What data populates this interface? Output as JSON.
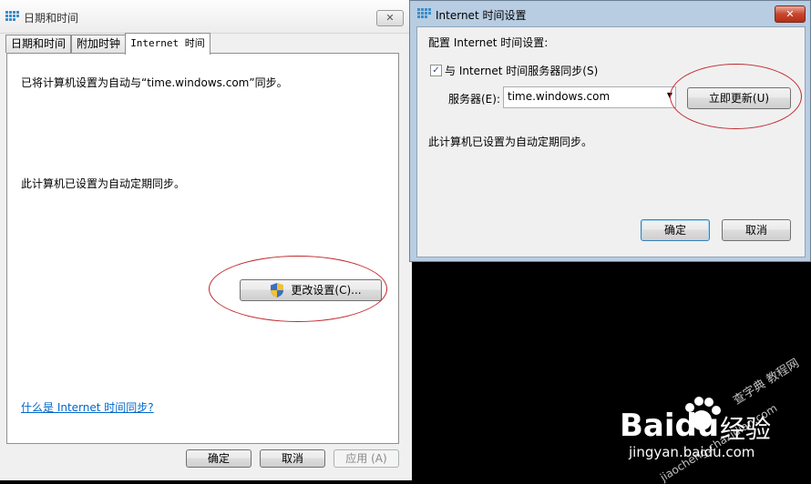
{
  "datetime_window": {
    "title": "日期和时间",
    "close_label": "✕",
    "tabs": [
      "日期和时间",
      "附加时钟",
      "Internet 时间"
    ],
    "status_line_1": "已将计算机设置为自动与“time.windows.com”同步。",
    "status_line_2": "此计算机已设置为自动定期同步。",
    "change_settings_label": "更改设置(C)...",
    "help_link": "什么是 Internet 时间同步?",
    "ok_label": "确定",
    "cancel_label": "取消",
    "apply_label": "应用 (A)"
  },
  "internet_time_dialog": {
    "title": "Internet 时间设置",
    "close_label": "✕",
    "config_label": "配置 Internet 时间设置:",
    "sync_checkbox_label": "与 Internet 时间服务器同步(S)",
    "sync_checked": true,
    "server_label": "服务器(E):",
    "server_value": "time.windows.com",
    "update_now_label": "立即更新(U)",
    "status_text": "此计算机已设置为自动定期同步。",
    "ok_label": "确定",
    "cancel_label": "取消"
  },
  "watermark": {
    "brand": "Baidu",
    "brand_cn": "经验",
    "url": "jingyan.baidu.com",
    "side": "查字典 教程网",
    "side_url": "jiaocheng.chazidian.com"
  }
}
